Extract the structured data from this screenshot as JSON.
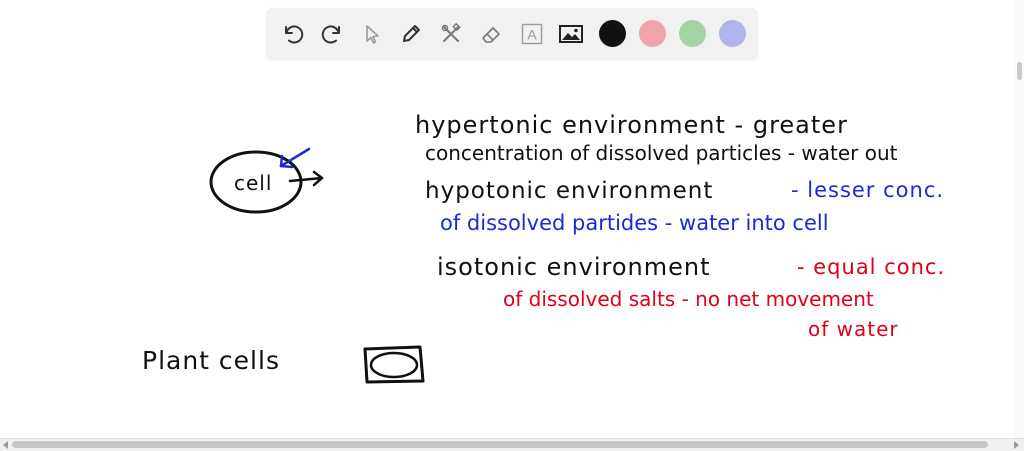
{
  "toolbar": {
    "tools": [
      {
        "icon": "undo-icon"
      },
      {
        "icon": "redo-icon"
      },
      {
        "icon": "select-pointer-icon"
      },
      {
        "icon": "pen-icon"
      },
      {
        "icon": "tools-icon"
      },
      {
        "icon": "eraser-icon"
      },
      {
        "icon": "text-icon",
        "glyph": "A"
      },
      {
        "icon": "image-icon"
      }
    ],
    "colors": [
      "#111111",
      "#f0a3aa",
      "#a4d4a4",
      "#b0b4ea"
    ],
    "selected_color": "#111111"
  },
  "notes": {
    "cell_label": "cell",
    "hypertonic_line1": "hypertonic environment - greater",
    "hypertonic_line2": "concentration of dissolved particles - water out",
    "hypotonic_line1_black": "hypotonic environment",
    "hypotonic_line1_blue": "- lesser conc.",
    "hypotonic_line2": "of dissolved partides - water into cell",
    "isotonic_line1_black": "isotonic environment",
    "isotonic_line1_red": "- equal conc.",
    "isotonic_line2": "of dissolved salts - no net movement",
    "isotonic_line3": "of water",
    "plant_label": "Plant cells"
  },
  "ink_colors": {
    "black": "#111111",
    "blue": "#1a2bd6",
    "red": "#e0001a"
  }
}
